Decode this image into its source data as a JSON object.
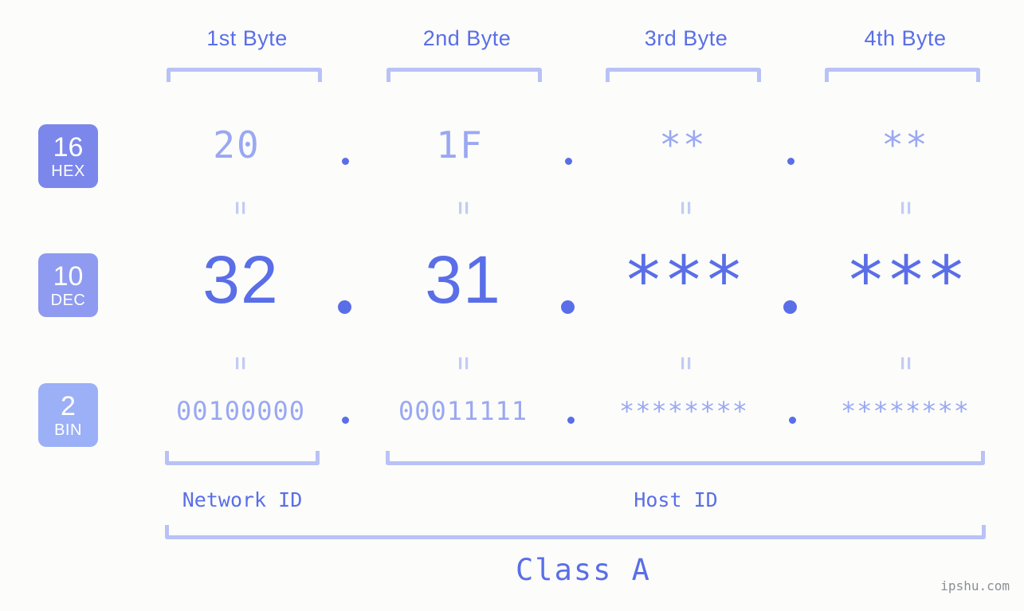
{
  "meta": {
    "background_color": "#fcfdfa",
    "accent_color": "#5a6ee8",
    "muted_accent_color": "#9aa8f2",
    "bracket_color": "#b9c2f7",
    "equality_color": "#c3cbf5",
    "watermark": "ipshu.com"
  },
  "columns": {
    "headers": [
      {
        "label": "1st Byte"
      },
      {
        "label": "2nd Byte"
      },
      {
        "label": "3rd Byte"
      },
      {
        "label": "4th Byte"
      }
    ]
  },
  "radix_badges": [
    {
      "number": "16",
      "name": "HEX",
      "color": "#7b87ea"
    },
    {
      "number": "10",
      "name": "DEC",
      "color": "#8e9bf0"
    },
    {
      "number": "2",
      "name": "BIN",
      "color": "#9cb0f7"
    }
  ],
  "rows": {
    "hex": {
      "radix": "16",
      "radix_name": "HEX",
      "values": [
        "20",
        "1F",
        "**",
        "**"
      ],
      "separator": "."
    },
    "dec": {
      "radix": "10",
      "radix_name": "DEC",
      "values": [
        "32",
        "31",
        "***",
        "***"
      ],
      "separator": "."
    },
    "bin": {
      "radix": "2",
      "radix_name": "BIN",
      "values": [
        "00100000",
        "00011111",
        "********",
        "********"
      ],
      "separator": "."
    }
  },
  "equality_marks": {
    "symbol": "=",
    "count_per_gap": 4,
    "gaps": [
      "hex-to-dec",
      "dec-to-bin"
    ]
  },
  "partitions": {
    "network_id": {
      "label": "Network ID",
      "spans_bytes": [
        1
      ]
    },
    "host_id": {
      "label": "Host ID",
      "spans_bytes": [
        2,
        3,
        4
      ]
    },
    "class": {
      "label": "Class A",
      "spans_bytes": [
        1,
        2,
        3,
        4
      ]
    }
  },
  "address": {
    "dotted_decimal": "32.31.***.***",
    "dotted_hex": "20.1F.**.**",
    "dotted_binary": "00100000.00011111.********.********",
    "class": "Class A"
  }
}
